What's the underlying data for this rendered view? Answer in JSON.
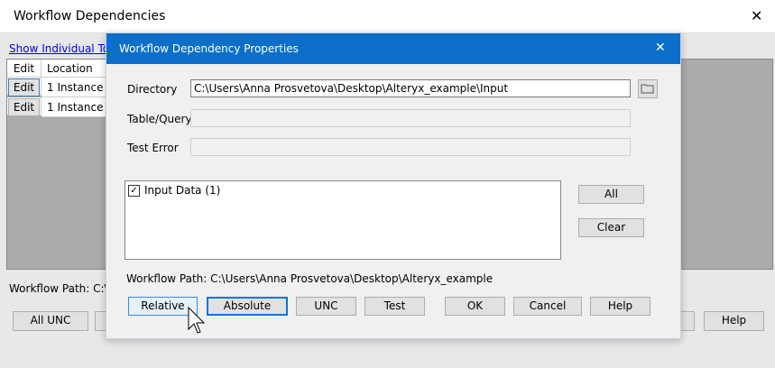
{
  "window": {
    "title": "Workflow Dependencies",
    "close": "✕"
  },
  "link": "Show Individual Tools",
  "table": {
    "headers": [
      "Edit",
      "Location"
    ],
    "rows": [
      {
        "edit": "Edit",
        "location": "1 Instance"
      },
      {
        "edit": "Edit",
        "location": "1 Instance"
      }
    ]
  },
  "workflow_path_label": "Workflow Path: C:\\U",
  "bottom_buttons": {
    "all_unc": "All UNC",
    "help": "Help"
  },
  "dialog": {
    "title": "Workflow Dependency Properties",
    "close": "✕",
    "directory_label": "Directory",
    "directory_value": "C:\\Users\\Anna Prosvetova\\Desktop\\Alteryx_example\\Input",
    "table_query_label": "Table/Query",
    "table_query_value": "",
    "test_error_label": "Test Error",
    "test_error_value": "",
    "list_items": [
      {
        "label": "Input Data (1)",
        "checked": true
      }
    ],
    "all": "All",
    "clear": "Clear",
    "workflow_path": "Workflow Path: C:\\Users\\Anna Prosvetova\\Desktop\\Alteryx_example",
    "buttons": {
      "relative": "Relative",
      "absolute": "Absolute",
      "unc": "UNC",
      "test": "Test",
      "ok": "OK",
      "cancel": "Cancel",
      "help": "Help"
    }
  }
}
